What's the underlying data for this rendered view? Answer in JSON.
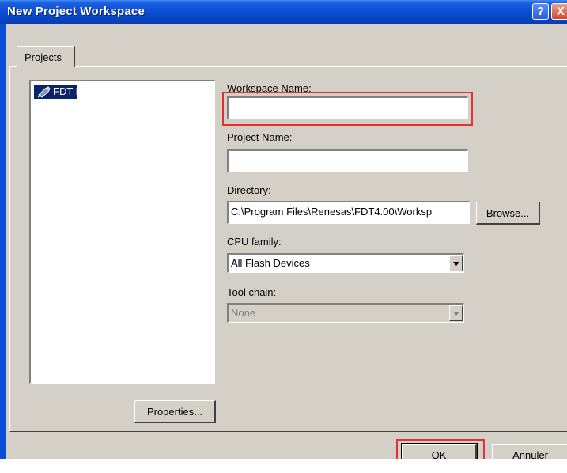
{
  "window": {
    "title": "New Project Workspace",
    "help_glyph": "?",
    "close_glyph": "X"
  },
  "tabs": [
    {
      "label": "Projects"
    }
  ],
  "project_list": {
    "items": [
      {
        "label": "FDT Project Generator",
        "icon": "project-generator-icon"
      }
    ]
  },
  "form": {
    "workspace_name": {
      "label": "Workspace Name:",
      "value": ""
    },
    "project_name": {
      "label": "Project Name:",
      "value": ""
    },
    "directory": {
      "label": "Directory:",
      "value": "C:\\Program Files\\Renesas\\FDT4.00\\Worksp"
    },
    "cpu_family": {
      "label": "CPU family:",
      "value": "All Flash Devices"
    },
    "tool_chain": {
      "label": "Tool chain:",
      "value": "None"
    }
  },
  "buttons": {
    "browse": "Browse...",
    "properties": "Properties...",
    "ok": "OK",
    "cancel": "Annuler"
  },
  "colors": {
    "titlebar": "#0a4fd6",
    "dialog_bg": "#d4d0c8",
    "selection": "#0a246a",
    "highlight_box": "#e3322f"
  }
}
